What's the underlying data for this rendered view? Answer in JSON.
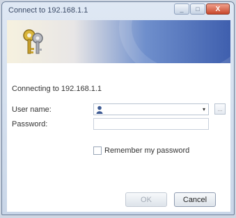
{
  "window": {
    "title": "Connect to 192.168.1.1"
  },
  "caption": {
    "minimize": "_",
    "maximize": "□",
    "close": "X"
  },
  "dialog": {
    "connecting_text": "Connecting to 192.168.1.1",
    "username_label": "User name:",
    "username_value": "",
    "password_label": "Password:",
    "password_value": "",
    "remember_label": "Remember my password",
    "remember_checked": false,
    "browse_label": "...",
    "dropdown_glyph": "▾",
    "ok_label": "OK",
    "cancel_label": "Cancel"
  },
  "icons": [
    "keys-icon",
    "user-icon",
    "dropdown-arrow-icon",
    "browse-button"
  ],
  "colors": {
    "banner_blue": "#3f5fae",
    "close_red": "#c8472a"
  }
}
